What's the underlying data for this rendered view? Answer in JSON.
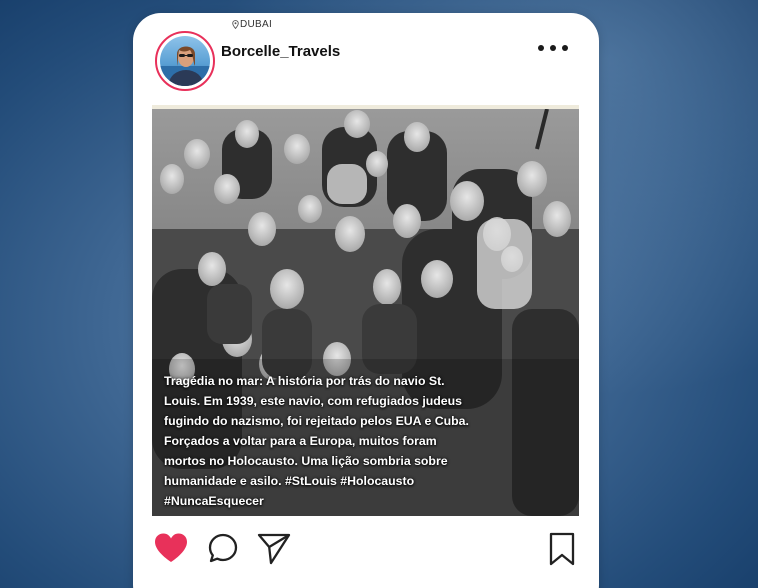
{
  "post": {
    "location": "DUBAI",
    "username": "Borcelle_Travels",
    "caption": "Tragédia no mar: A história por trás do navio St.\nLouis. Em 1939, este navio, com refugiados judeus\nfugindo do nazismo, foi rejeitado pelos EUA e Cuba.\nForçados a voltar para a Europa, muitos foram\nmortos no Holocausto. Uma lição sombria sobre\nhumanidade e asilo. #StLouis #Holocausto\n#NuncaEsquecer"
  },
  "icons": {
    "location": "map-pin-icon",
    "more": "more-options-icon",
    "like": "heart-icon",
    "comment": "comment-icon",
    "share": "share-icon",
    "save": "bookmark-icon"
  },
  "colors": {
    "like": "#e8315a",
    "avatar_ring": "#e8305a",
    "card": "#ffffff",
    "icon_stroke": "#222222"
  }
}
